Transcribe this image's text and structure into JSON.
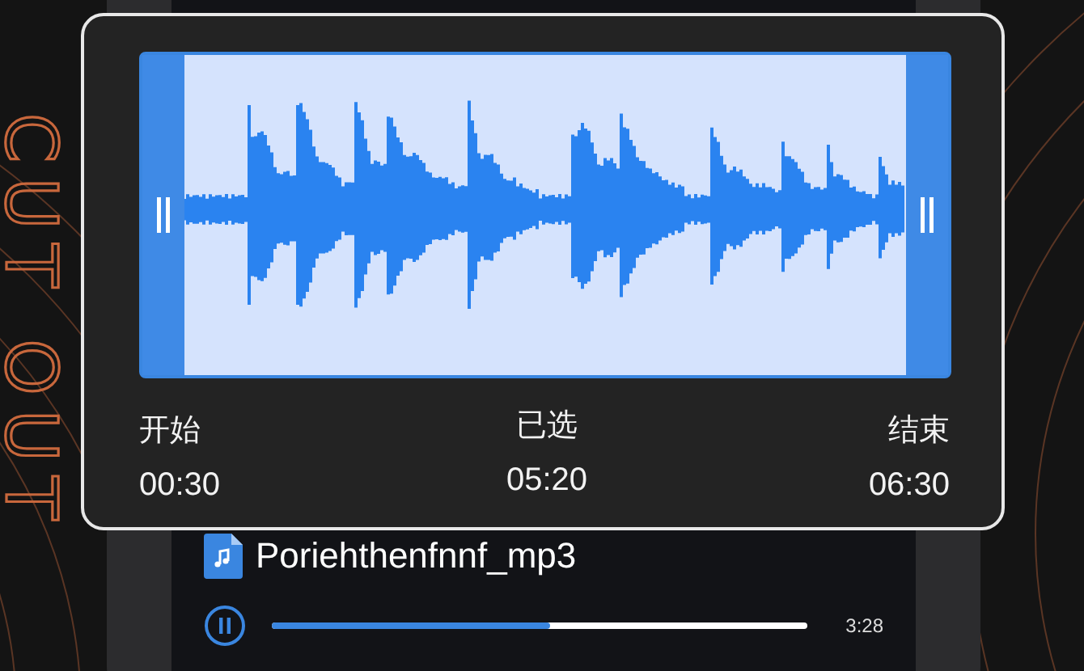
{
  "decoration": {
    "vertical_text": "CUT OUT"
  },
  "trimmer": {
    "start": {
      "label": "开始",
      "time": "00:30"
    },
    "selected": {
      "label": "已选",
      "time": "05:20"
    },
    "end": {
      "label": "结束",
      "time": "06:30"
    }
  },
  "player": {
    "file_name": "Poriehthenfnnf_mp3",
    "playing": true,
    "level": 0.52,
    "duration": "3:28"
  }
}
